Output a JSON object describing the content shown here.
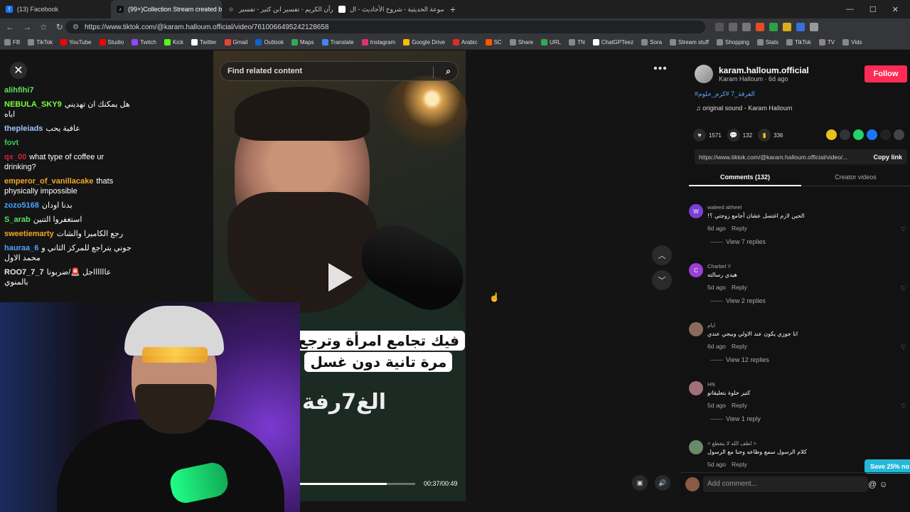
{
  "browser": {
    "tabs": [
      {
        "title": "(13) Facebook",
        "color": "#1877f2",
        "glyph": "f"
      },
      {
        "title": "(99+)Collection Stream created by",
        "color": "#111111",
        "glyph": "♪"
      },
      {
        "title": "القرآن الكريم - تفسير ابن كثير - تفسير",
        "color": "#888888",
        "glyph": "◎"
      },
      {
        "title": "الموسوعة الحديثية - شروح الأحاديث - ال",
        "color": "#ffffff",
        "glyph": ""
      }
    ],
    "new_tab": "+",
    "url": "https://www.tiktok.com/@karam.halloum.official/video/7610066495242128658",
    "bookmarks": [
      {
        "label": "FB",
        "color": "#888"
      },
      {
        "label": "TikTok",
        "color": "#888"
      },
      {
        "label": "YouTube",
        "color": "#ff0000"
      },
      {
        "label": "Studio",
        "color": "#ff0000"
      },
      {
        "label": "Twitch",
        "color": "#9146ff"
      },
      {
        "label": "Kick",
        "color": "#53fc18"
      },
      {
        "label": "Twitter",
        "color": "#ffffff"
      },
      {
        "label": "Gmail",
        "color": "#ea4335"
      },
      {
        "label": "Outlook",
        "color": "#0a64d8"
      },
      {
        "label": "Maps",
        "color": "#34a853"
      },
      {
        "label": "Translate",
        "color": "#4285f4"
      },
      {
        "label": "Instagram",
        "color": "#e1306c"
      },
      {
        "label": "Google Drive",
        "color": "#fbbc04"
      },
      {
        "label": "Arabic",
        "color": "#d93025"
      },
      {
        "label": "SC",
        "color": "#ff5500"
      },
      {
        "label": "Share",
        "color": "#888"
      },
      {
        "label": "URL",
        "color": "#34a853"
      },
      {
        "label": "TN",
        "color": "#888"
      },
      {
        "label": "ChatGPTeez",
        "color": "#ffffff"
      },
      {
        "label": "Sora",
        "color": "#888"
      },
      {
        "label": "Stream stuff",
        "color": "#888"
      },
      {
        "label": "Shopping",
        "color": "#888"
      },
      {
        "label": "Stats",
        "color": "#888"
      },
      {
        "label": "TikTok",
        "color": "#888"
      },
      {
        "label": "TV",
        "color": "#888"
      },
      {
        "label": "Vids",
        "color": "#888"
      }
    ]
  },
  "chat": [
    {
      "user": "alihfihi7",
      "color": "#5be35b",
      "text": ""
    },
    {
      "user": "NEBULA_SKY9",
      "color": "#7cff3c",
      "text": "هل يمكنك ان تهديني اياه"
    },
    {
      "user": "thepleiads",
      "color": "#9fc3ff",
      "text": "عافية يحب"
    },
    {
      "user": "fovt",
      "color": "#2fd24f",
      "text": ""
    },
    {
      "user": "qx_00",
      "color": "#d3233c",
      "text": "what type of coffee ur drinking?"
    },
    {
      "user": "emperor_of_vanillacake",
      "color": "#f5a623",
      "text": "thats physically impossible"
    },
    {
      "user": "zozo5168",
      "color": "#4aa3ff",
      "text": "بدنا اودان"
    },
    {
      "user": "S_arab",
      "color": "#5be35b",
      "text": "استغفروا التنين"
    },
    {
      "user": "sweetiemarty",
      "color": "#f5a623",
      "text": "رجع الكاميرا والشات"
    },
    {
      "user": "hauraa_6",
      "color": "#4aa3ff",
      "text": "جوني يتراجع للمركز الثاني و محمد الاول"
    },
    {
      "user": "ROO7_7_7",
      "color": "#e8e8e8",
      "text": "عااااااجل 🚨/ضربونا بالمنوي"
    }
  ],
  "video": {
    "search_placeholder": "Find related content",
    "caption_line1": "فيك تجامع امرأة وترجع",
    "caption_line2": "مرة تانية دون غسل",
    "watermark": "الغ7رفة",
    "time": "00:37/00:49",
    "progress": 0.755
  },
  "post": {
    "username": "karam.halloum.official",
    "meta": "Karam Halloum · 6d ago",
    "follow_label": "Follow",
    "tags": "#الغرفة_7 #كرم_حلوم",
    "sound": "original sound - Karam Halloum",
    "likes": "1571",
    "comments": "132",
    "saves": "336",
    "link": "https://www.tiktok.com/@karam.halloum.official/video/...",
    "copy_label": "Copy link",
    "tab_comments": "Comments (132)",
    "tab_creator": "Creator videos"
  },
  "comments": [
    {
      "name": "waleed alrheel",
      "avatar": "W",
      "avatar_color": "#7a3fd6",
      "text": "الحين لازم اغتسل عشان أجامع زوجتي ؟!",
      "age": "6d ago",
      "reply": "Reply",
      "view": "View 7 replies"
    },
    {
      "name": "Charbel Y",
      "avatar": "C",
      "avatar_color": "#9b3fd6",
      "text": "هيدي رسالته",
      "age": "5d ago",
      "reply": "Reply",
      "view": "View 2 replies"
    },
    {
      "name": "ايام",
      "avatar": "",
      "avatar_color": "#8a6a5a",
      "text": "انا جوزي يكون عند الاولي وبيجي عندي",
      "age": "6d ago",
      "reply": "Reply",
      "view": "View 12 replies"
    },
    {
      "name": "HN",
      "avatar": "",
      "avatar_color": "#a0707a",
      "text": "كتير حلوة بتعليقاتو",
      "age": "5d ago",
      "reply": "Reply",
      "view": "View 1 reply"
    },
    {
      "name": "< لطف الله لا ينقطع >",
      "avatar": "",
      "avatar_color": "#6a8a6a",
      "text": "كلام الرسول سمع وطاعه وحنا مع الرسول",
      "age": "5d ago",
      "reply": "Reply",
      "view": ""
    }
  ],
  "add_comment_placeholder": "Add comment...",
  "promo": "Save 25% no"
}
